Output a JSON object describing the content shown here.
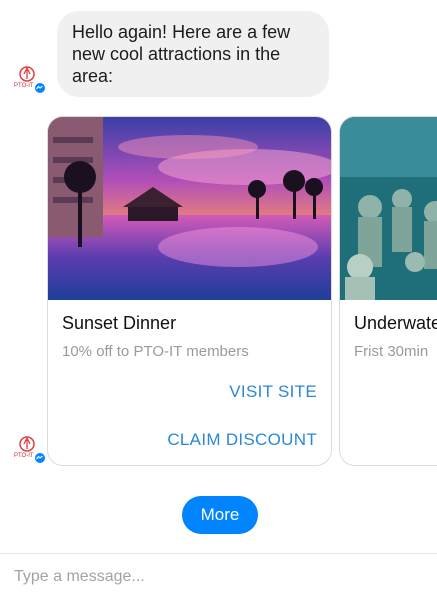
{
  "bot": {
    "avatar_label": "PTO-IT"
  },
  "message": {
    "text": "Hello again! Here are a few new cool attractions in the area:"
  },
  "cards": [
    {
      "title": "Sunset Dinner",
      "subtitle": "10% off to PTO-IT members",
      "buttons": [
        "VISIT SITE",
        "CLAIM DISCOUNT"
      ],
      "image": "sunset-resort-pool-image"
    },
    {
      "title": "Underwate",
      "subtitle": "Frist 30min",
      "image": "underwater-statues-image"
    }
  ],
  "quick_reply": {
    "label": "More"
  },
  "composer": {
    "placeholder": "Type a message..."
  },
  "colors": {
    "accent": "#0084ff",
    "link": "#2a88d8",
    "bubble": "#f0f0f0"
  }
}
